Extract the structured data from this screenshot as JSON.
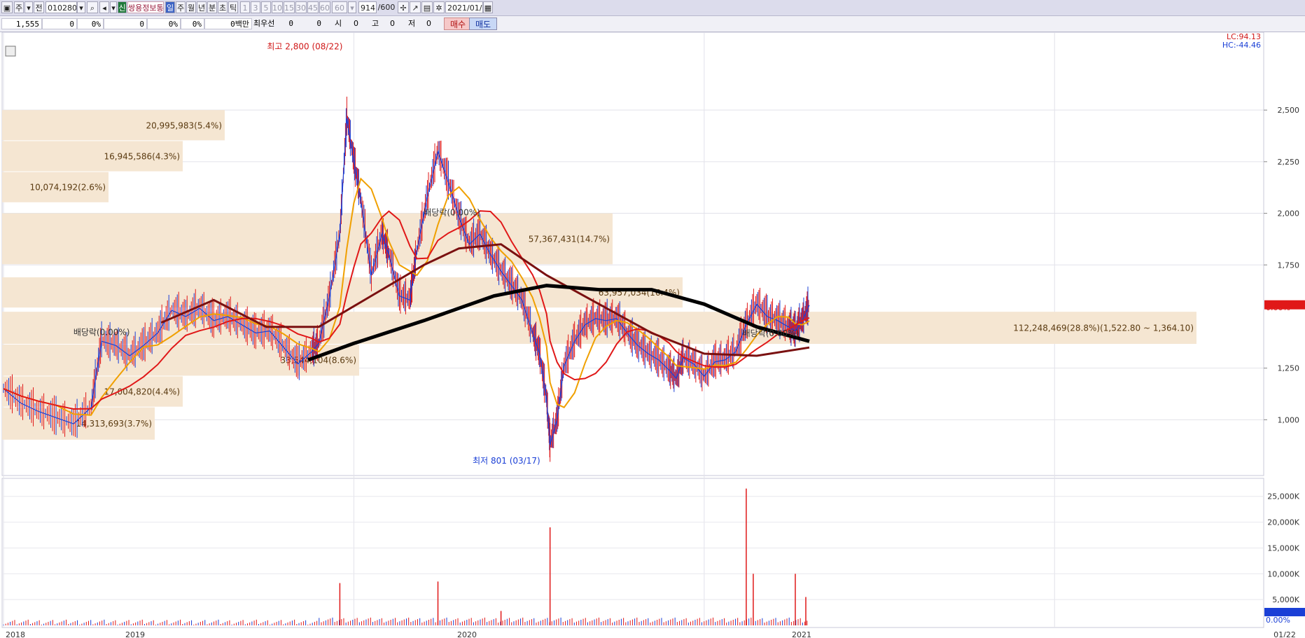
{
  "toolbar": {
    "code": "010280",
    "market_badge": "신",
    "name": "쌍용정보통",
    "periods": [
      "일",
      "주",
      "월",
      "년",
      "분",
      "초",
      "틱"
    ],
    "intervals": [
      "1",
      "3",
      "5",
      "10",
      "15",
      "30",
      "45",
      "60",
      "60"
    ],
    "count": "914",
    "count_max": "/600",
    "date": "2021/01/22"
  },
  "infobar": {
    "price": "1,555",
    "v1": "0",
    "v2": "0%",
    "v3": "0",
    "v4": "0%",
    "v5": "0%",
    "amount": "0백만",
    "quote_label": "최우선",
    "q1": "0",
    "q2": "0",
    "open_label": "시",
    "open": "0",
    "high_label": "고",
    "high": "0",
    "low_label": "저",
    "low": "0",
    "buy": "매수",
    "sell": "매도"
  },
  "colors": {
    "candle": "#1a3fd6",
    "ma5": "#1a3fd6",
    "ma10": "#f0a000",
    "ma20": "#e01818",
    "ma60": "#7a1010",
    "ma120": "#000000",
    "vp_band": "#f5e6d2",
    "vol_up": "#e01818",
    "vol_down": "#1a3fd6"
  },
  "chart_data": {
    "type": "candlestick",
    "ylim": [
      801,
      2850
    ],
    "yticks": [
      "2,500",
      "2,250",
      "2,000",
      "1,750",
      "1,250",
      "1,000"
    ],
    "ytick_values": [
      2500,
      2250,
      2000,
      1750,
      1250,
      1000
    ],
    "x_labels": [
      "2018",
      "2019",
      "2020",
      "2021"
    ],
    "x_label_values": [
      0,
      1,
      2,
      3
    ],
    "last_date_label": "01/22",
    "lc": "LC:94.13",
    "hc": "HC:-44.46",
    "current_price": "1,555",
    "current_change": "0.00%",
    "high_marker": "최고 2,800 (08/22)",
    "low_marker": "최저 801 (03/17)",
    "dividend_labels": [
      "배당락(0.00%)",
      "배당락(0.00%)",
      "배당락(0.00%)"
    ],
    "volume_profile": [
      {
        "label": "20,995,983(5.4%)",
        "low": 2350,
        "high": 2500
      },
      {
        "label": "16,945,586(4.3%)",
        "low": 2200,
        "high": 2350
      },
      {
        "label": "10,074,192(2.6%)",
        "low": 2050,
        "high": 2200
      },
      {
        "label": "57,367,431(14.7%)",
        "low": 1750,
        "high": 2000
      },
      {
        "label": "63,957,034(16.4%)",
        "low": 1540,
        "high": 1690
      },
      {
        "label": "112,248,469(28.8%)(1,522.80 ~ 1,364.10)",
        "low": 1364,
        "high": 1523
      },
      {
        "label": "33,544,104(8.6%)",
        "low": 1210,
        "high": 1364
      },
      {
        "label": "17,004,820(4.4%)",
        "low": 1060,
        "high": 1210
      },
      {
        "label": "14,313,693(3.7%)",
        "low": 900,
        "high": 1060
      }
    ],
    "price_series": [
      [
        0.0,
        1150
      ],
      [
        0.05,
        1080
      ],
      [
        0.1,
        1040
      ],
      [
        0.15,
        1010
      ],
      [
        0.2,
        980
      ],
      [
        0.25,
        1060
      ],
      [
        0.28,
        1380
      ],
      [
        0.32,
        1360
      ],
      [
        0.36,
        1310
      ],
      [
        0.4,
        1360
      ],
      [
        0.44,
        1420
      ],
      [
        0.48,
        1530
      ],
      [
        0.52,
        1500
      ],
      [
        0.56,
        1540
      ],
      [
        0.6,
        1480
      ],
      [
        0.64,
        1500
      ],
      [
        0.68,
        1460
      ],
      [
        0.72,
        1420
      ],
      [
        0.76,
        1430
      ],
      [
        0.8,
        1350
      ],
      [
        0.84,
        1270
      ],
      [
        0.88,
        1330
      ],
      [
        0.9,
        1370
      ],
      [
        0.93,
        1590
      ],
      [
        0.96,
        1900
      ],
      [
        0.98,
        2460
      ],
      [
        1.0,
        2250
      ],
      [
        1.02,
        2060
      ],
      [
        1.05,
        1700
      ],
      [
        1.08,
        1900
      ],
      [
        1.1,
        1800
      ],
      [
        1.13,
        1600
      ],
      [
        1.16,
        1580
      ],
      [
        1.18,
        1820
      ],
      [
        1.21,
        2080
      ],
      [
        1.24,
        2300
      ],
      [
        1.27,
        2150
      ],
      [
        1.3,
        1980
      ],
      [
        1.33,
        1850
      ],
      [
        1.36,
        1900
      ],
      [
        1.39,
        1800
      ],
      [
        1.42,
        1720
      ],
      [
        1.45,
        1650
      ],
      [
        1.48,
        1580
      ],
      [
        1.51,
        1420
      ],
      [
        1.53,
        1320
      ],
      [
        1.55,
        1100
      ],
      [
        1.56,
        880
      ],
      [
        1.58,
        1000
      ],
      [
        1.6,
        1260
      ],
      [
        1.63,
        1380
      ],
      [
        1.66,
        1460
      ],
      [
        1.69,
        1490
      ],
      [
        1.72,
        1480
      ],
      [
        1.75,
        1490
      ],
      [
        1.78,
        1420
      ],
      [
        1.81,
        1360
      ],
      [
        1.84,
        1320
      ],
      [
        1.87,
        1290
      ],
      [
        1.9,
        1240
      ],
      [
        1.92,
        1200
      ],
      [
        1.94,
        1300
      ],
      [
        1.97,
        1270
      ],
      [
        2.0,
        1210
      ],
      [
        2.03,
        1280
      ],
      [
        2.06,
        1290
      ],
      [
        2.09,
        1330
      ],
      [
        2.12,
        1460
      ],
      [
        2.15,
        1560
      ],
      [
        2.18,
        1500
      ],
      [
        2.21,
        1480
      ],
      [
        2.24,
        1450
      ],
      [
        2.26,
        1430
      ],
      [
        2.28,
        1480
      ],
      [
        2.3,
        1555
      ]
    ],
    "ma120_series": [
      [
        0.87,
        1290
      ],
      [
        1.0,
        1370
      ],
      [
        1.2,
        1480
      ],
      [
        1.4,
        1600
      ],
      [
        1.55,
        1650
      ],
      [
        1.7,
        1630
      ],
      [
        1.85,
        1630
      ],
      [
        2.0,
        1560
      ],
      [
        2.15,
        1450
      ],
      [
        2.3,
        1380
      ]
    ],
    "ma60_series": [
      [
        0.45,
        1470
      ],
      [
        0.6,
        1580
      ],
      [
        0.75,
        1450
      ],
      [
        0.9,
        1450
      ],
      [
        1.05,
        1600
      ],
      [
        1.2,
        1750
      ],
      [
        1.3,
        1830
      ],
      [
        1.42,
        1850
      ],
      [
        1.55,
        1700
      ],
      [
        1.7,
        1560
      ],
      [
        1.85,
        1420
      ],
      [
        2.0,
        1320
      ],
      [
        2.15,
        1310
      ],
      [
        2.3,
        1350
      ]
    ],
    "volume_ylim": [
      0,
      27000
    ],
    "volume_yticks": [
      "25,000K",
      "20,000K",
      "15,000K",
      "10,000K",
      "5,000K"
    ],
    "volume_ytick_values": [
      25000,
      20000,
      15000,
      10000,
      5000
    ],
    "volume_current": "0",
    "volume_change": "0.00%",
    "volume_spikes": [
      [
        0.96,
        8200
      ],
      [
        1.24,
        8500
      ],
      [
        1.42,
        2800
      ],
      [
        1.56,
        19000
      ],
      [
        2.12,
        26500
      ],
      [
        2.14,
        10000
      ],
      [
        2.26,
        10000
      ],
      [
        2.29,
        5500
      ]
    ]
  }
}
